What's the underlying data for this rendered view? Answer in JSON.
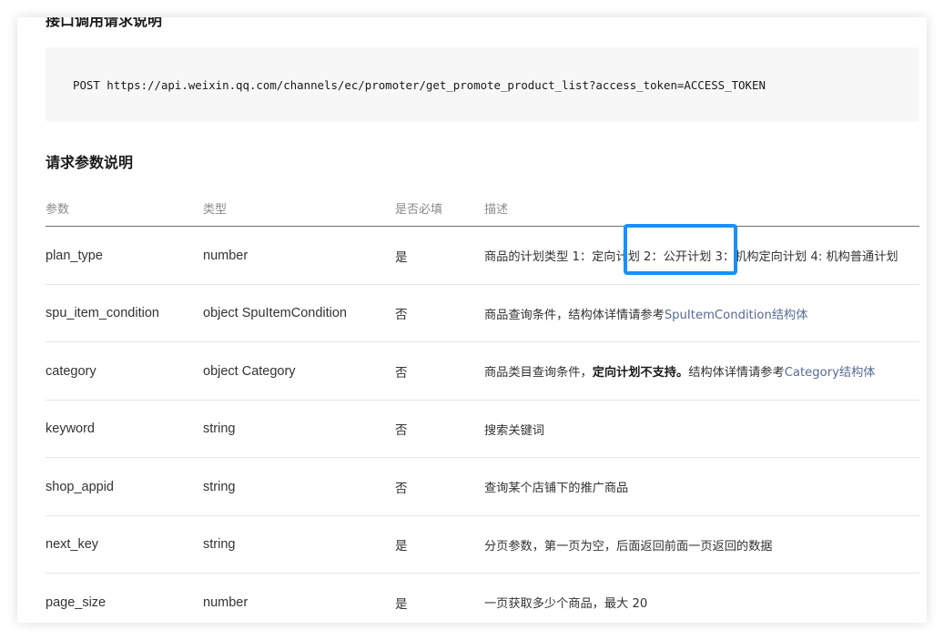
{
  "sections": {
    "request_title": "接口调用请求说明",
    "params_title": "请求参数说明"
  },
  "request": {
    "code": "POST https://api.weixin.qq.com/channels/ec/promoter/get_promote_product_list?access_token=ACCESS_TOKEN"
  },
  "table": {
    "headers": [
      "参数",
      "类型",
      "是否必填",
      "描述"
    ],
    "rows": [
      {
        "param": "plan_type",
        "type": "number",
        "required": "是",
        "desc": "商品的计划类型 1：定向计划 2：公开计划 3：机构定向计划 4: 机构普通计划"
      },
      {
        "param": "spu_item_condition",
        "type": "object SpuItemCondition",
        "required": "否",
        "desc_pre": "商品查询条件，结构体详情请参考",
        "desc_link": "SpuItemCondition结构体"
      },
      {
        "param": "category",
        "type": "object Category",
        "required": "否",
        "desc_pre": "商品类目查询条件，",
        "desc_bold": "定向计划不支持。",
        "desc_mid": "结构体详情请参考",
        "desc_link": "Category结构体"
      },
      {
        "param": "keyword",
        "type": "string",
        "required": "否",
        "desc": "搜索关键词"
      },
      {
        "param": "shop_appid",
        "type": "string",
        "required": "否",
        "desc": "查询某个店铺下的推广商品"
      },
      {
        "param": "next_key",
        "type": "string",
        "required": "是",
        "desc": "分页参数，第一页为空，后面返回前面一页返回的数据"
      },
      {
        "param": "page_size",
        "type": "number",
        "required": "是",
        "desc": "一页获取多少个商品，最大 20"
      }
    ]
  },
  "colors": {
    "link": "#576b95",
    "highlight": "#1890ff"
  }
}
